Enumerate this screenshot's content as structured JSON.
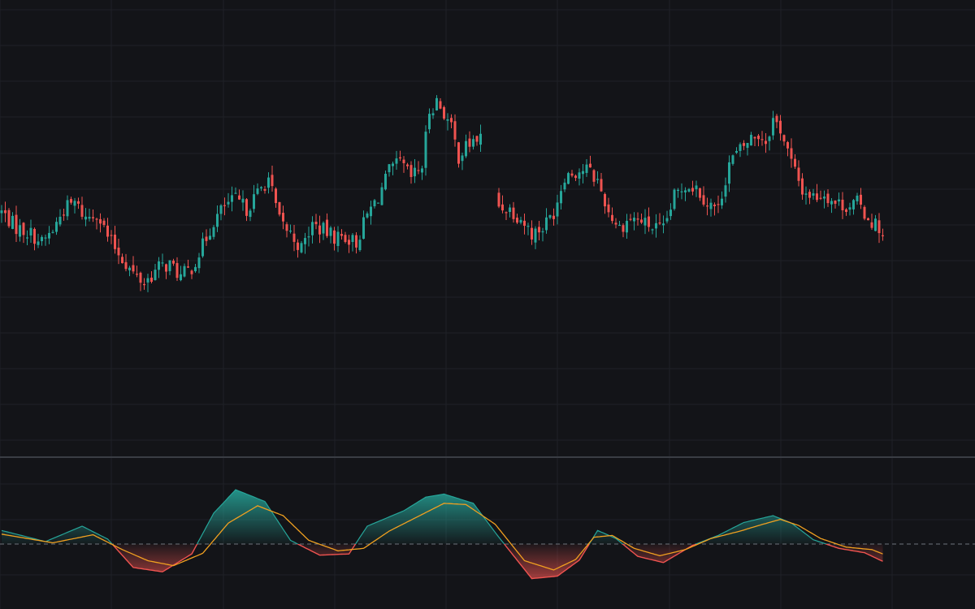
{
  "colors": {
    "background": "#131418",
    "grid": "#1f2127",
    "divider": "#3a3d44",
    "up": "#26a69a",
    "down": "#ef5350",
    "signal": "#f0a020",
    "zero_line": "#6f737b"
  },
  "chart_data": [
    {
      "type": "candlestick",
      "title": "",
      "xlabel": "",
      "ylabel": "",
      "x_range": [
        0,
        1200
      ],
      "y_range": [
        0,
        100
      ],
      "grid": true,
      "legend": "none",
      "gap": [
        [
          131,
          136
        ]
      ],
      "close_keypoints": [
        [
          0,
          55
        ],
        [
          4,
          50
        ],
        [
          8,
          48
        ],
        [
          11,
          45
        ],
        [
          14,
          49
        ],
        [
          17,
          56
        ],
        [
          20,
          58
        ],
        [
          23,
          53
        ],
        [
          26,
          55
        ],
        [
          29,
          47
        ],
        [
          33,
          40
        ],
        [
          36,
          35
        ],
        [
          39,
          32
        ],
        [
          43,
          37
        ],
        [
          46,
          38
        ],
        [
          49,
          34
        ],
        [
          52,
          37
        ],
        [
          55,
          44
        ],
        [
          58,
          52
        ],
        [
          61,
          57
        ],
        [
          64,
          59
        ],
        [
          67,
          56
        ],
        [
          70,
          61
        ],
        [
          73,
          66
        ],
        [
          76,
          52
        ],
        [
          79,
          48
        ],
        [
          82,
          43
        ],
        [
          85,
          51
        ],
        [
          88,
          49
        ],
        [
          91,
          47
        ],
        [
          94,
          47
        ],
        [
          97,
          45
        ],
        [
          100,
          54
        ],
        [
          103,
          60
        ],
        [
          106,
          68
        ],
        [
          109,
          71
        ],
        [
          112,
          66
        ],
        [
          115,
          70
        ],
        [
          117,
          88
        ],
        [
          119,
          91
        ],
        [
          121,
          87
        ],
        [
          123,
          82
        ],
        [
          125,
          73
        ],
        [
          127,
          76
        ],
        [
          129,
          78
        ],
        [
          131,
          79
        ],
        [
          136,
          57
        ],
        [
          139,
          56
        ],
        [
          142,
          53
        ],
        [
          145,
          48
        ],
        [
          148,
          50
        ],
        [
          151,
          55
        ],
        [
          154,
          67
        ],
        [
          157,
          68
        ],
        [
          160,
          69
        ],
        [
          163,
          65
        ],
        [
          166,
          55
        ],
        [
          169,
          50
        ],
        [
          172,
          53
        ],
        [
          175,
          52
        ],
        [
          178,
          50
        ],
        [
          181,
          49
        ],
        [
          184,
          60
        ],
        [
          187,
          64
        ],
        [
          190,
          63
        ],
        [
          193,
          58
        ],
        [
          196,
          56
        ],
        [
          199,
          71
        ],
        [
          202,
          75
        ],
        [
          205,
          79
        ],
        [
          207,
          80
        ],
        [
          209,
          78
        ],
        [
          211,
          85
        ],
        [
          213,
          82
        ],
        [
          216,
          71
        ],
        [
          219,
          62
        ],
        [
          222,
          60
        ],
        [
          225,
          61
        ],
        [
          228,
          58
        ],
        [
          231,
          57
        ],
        [
          234,
          58
        ],
        [
          237,
          53
        ],
        [
          240,
          50
        ],
        [
          241,
          47
        ]
      ]
    },
    {
      "type": "area",
      "title": "",
      "series": [
        {
          "values": [
            [
              0,
              2.2
            ],
            [
              12,
              0.4
            ],
            [
              22,
              2.9
            ],
            [
              29,
              0.8
            ],
            [
              36,
              -3.8
            ],
            [
              44,
              -4.5
            ],
            [
              52,
              -1.6
            ],
            [
              58,
              5.0
            ],
            [
              64,
              8.8
            ],
            [
              72,
              6.9
            ],
            [
              79,
              0.6
            ],
            [
              87,
              -1.8
            ],
            [
              95,
              -1.6
            ],
            [
              100,
              2.9
            ],
            [
              110,
              5.4
            ],
            [
              116,
              7.6
            ],
            [
              121,
              8.1
            ],
            [
              129,
              6.6
            ],
            [
              136,
              1.1
            ],
            [
              145,
              -5.6
            ],
            [
              152,
              -5.2
            ],
            [
              158,
              -2.6
            ],
            [
              163,
              2.2
            ],
            [
              168,
              0.9
            ],
            [
              174,
              -2.0
            ],
            [
              181,
              -3.0
            ],
            [
              189,
              -0.2
            ],
            [
              196,
              1.4
            ],
            [
              203,
              3.5
            ],
            [
              211,
              4.6
            ],
            [
              216,
              3.4
            ],
            [
              222,
              0.7
            ],
            [
              229,
              -0.7
            ],
            [
              236,
              -1.4
            ],
            [
              241,
              -2.8
            ]
          ]
        },
        {
          "values": [
            [
              0,
              1.6
            ],
            [
              14,
              0.2
            ],
            [
              25,
              1.5
            ],
            [
              33,
              -0.9
            ],
            [
              40,
              -2.7
            ],
            [
              47,
              -3.5
            ],
            [
              55,
              -1.5
            ],
            [
              62,
              3.4
            ],
            [
              70,
              6.2
            ],
            [
              77,
              4.6
            ],
            [
              84,
              0.6
            ],
            [
              92,
              -1.1
            ],
            [
              99,
              -0.7
            ],
            [
              106,
              2.1
            ],
            [
              114,
              4.5
            ],
            [
              121,
              6.6
            ],
            [
              127,
              6.4
            ],
            [
              135,
              3.2
            ],
            [
              143,
              -2.7
            ],
            [
              151,
              -4.2
            ],
            [
              157,
              -2.5
            ],
            [
              162,
              1.1
            ],
            [
              167,
              1.4
            ],
            [
              173,
              -0.7
            ],
            [
              180,
              -1.9
            ],
            [
              187,
              -0.9
            ],
            [
              194,
              0.9
            ],
            [
              202,
              2.1
            ],
            [
              207,
              3.0
            ],
            [
              213,
              4.0
            ],
            [
              218,
              3.0
            ],
            [
              224,
              0.9
            ],
            [
              231,
              -0.5
            ],
            [
              238,
              -0.9
            ],
            [
              241,
              -1.6
            ]
          ]
        }
      ],
      "zero_line": true,
      "legend": "none"
    }
  ]
}
